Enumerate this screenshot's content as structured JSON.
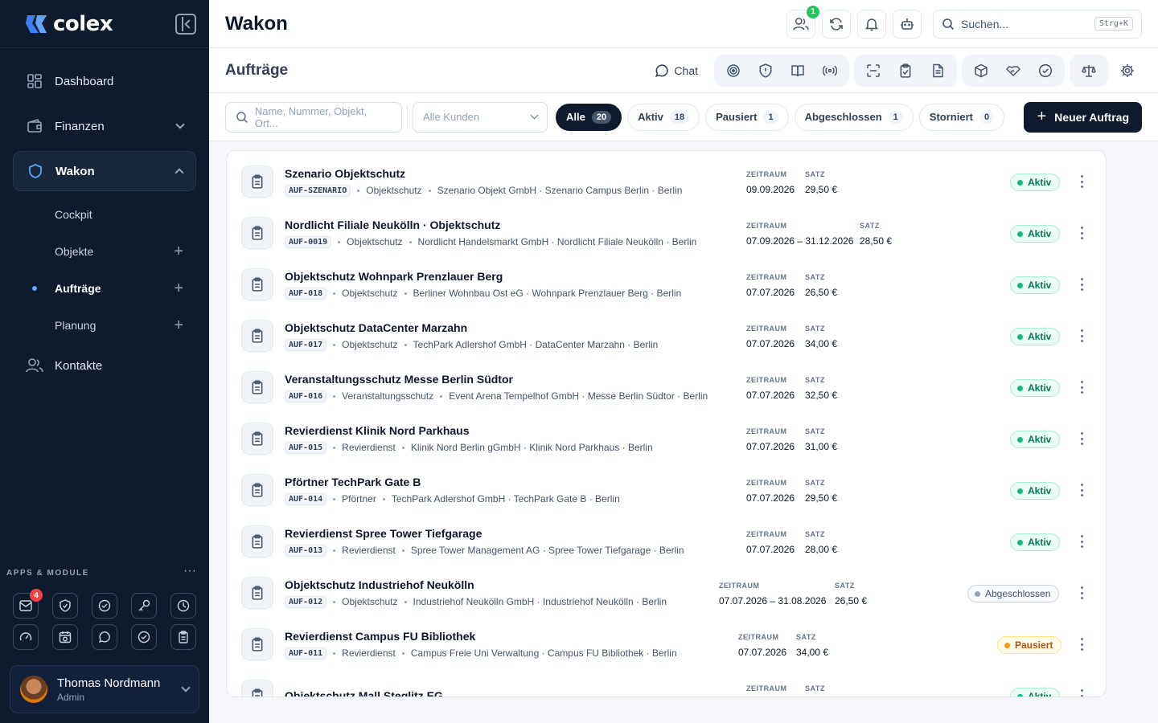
{
  "brand": {
    "name": "colex"
  },
  "sidebar": {
    "items": [
      {
        "label": "Dashboard"
      },
      {
        "label": "Finanzen"
      },
      {
        "label": "Wakon"
      },
      {
        "label": "Kontakte"
      }
    ],
    "sub": [
      {
        "label": "Cockpit"
      },
      {
        "label": "Objekte",
        "plus": "+"
      },
      {
        "label": "Aufträge",
        "plus": "+"
      },
      {
        "label": "Planung",
        "plus": "+"
      }
    ],
    "apps_title": "APPS & MODULE",
    "apps_more": "···",
    "mail_badge": "4",
    "user": {
      "name": "Thomas Nordmann",
      "role": "Admin"
    }
  },
  "topbar": {
    "title": "Wakon",
    "team_badge": "1",
    "search_placeholder": "Suchen...",
    "shortcut": "Strg+K"
  },
  "section": {
    "title": "Aufträge",
    "chat_label": "Chat"
  },
  "filters": {
    "search_placeholder": "Name, Nummer, Objekt, Ort...",
    "customer_placeholder": "Alle Kunden",
    "pills": [
      {
        "label": "Alle",
        "count": "20"
      },
      {
        "label": "Aktiv",
        "count": "18"
      },
      {
        "label": "Pausiert",
        "count": "1"
      },
      {
        "label": "Abgeschlossen",
        "count": "1"
      },
      {
        "label": "Storniert",
        "count": "0"
      }
    ],
    "new_label": "Neuer Auftrag"
  },
  "labels": {
    "zeitraum": "ZEITRAUM",
    "satz": "SATZ"
  },
  "orders": [
    {
      "title": "Szenario Objektschutz",
      "code": "AUF-SZENARIO",
      "type": "Objektschutz",
      "location": "Szenario Objekt GmbH · Szenario Campus Berlin · Berlin",
      "zeitraum": "09.09.2026",
      "satz": "29,50 €",
      "status": "Aktiv"
    },
    {
      "title": "Nordlicht Filiale Neukölln · Objektschutz",
      "code": "AUF-0019",
      "type": "Objektschutz",
      "location": "Nordlicht Handelsmarkt GmbH · Nordlicht Filiale Neukölln · Berlin",
      "zeitraum": "07.09.2026 – 31.12.2026",
      "satz": "28,50 €",
      "status": "Aktiv"
    },
    {
      "title": "Objektschutz Wohnpark Prenzlauer Berg",
      "code": "AUF-018",
      "type": "Objektschutz",
      "location": "Berliner Wohnbau Ost eG · Wohnpark Prenzlauer Berg · Berlin",
      "zeitraum": "07.07.2026",
      "satz": "26,50 €",
      "status": "Aktiv"
    },
    {
      "title": "Objektschutz DataCenter Marzahn",
      "code": "AUF-017",
      "type": "Objektschutz",
      "location": "TechPark Adlershof GmbH · DataCenter Marzahn · Berlin",
      "zeitraum": "07.07.2026",
      "satz": "34,00 €",
      "status": "Aktiv"
    },
    {
      "title": "Veranstaltungsschutz Messe Berlin Südtor",
      "code": "AUF-016",
      "type": "Veranstaltungsschutz",
      "location": "Event Arena Tempelhof GmbH · Messe Berlin Südtor · Berlin",
      "zeitraum": "07.07.2026",
      "satz": "32,50 €",
      "status": "Aktiv"
    },
    {
      "title": "Revierdienst Klinik Nord Parkhaus",
      "code": "AUF-015",
      "type": "Revierdienst",
      "location": "Klinik Nord Berlin gGmbH · Klinik Nord Parkhaus · Berlin",
      "zeitraum": "07.07.2026",
      "satz": "31,00 €",
      "status": "Aktiv"
    },
    {
      "title": "Pförtner TechPark Gate B",
      "code": "AUF-014",
      "type": "Pförtner",
      "location": "TechPark Adlershof GmbH · TechPark Gate B · Berlin",
      "zeitraum": "07.07.2026",
      "satz": "29,50 €",
      "status": "Aktiv"
    },
    {
      "title": "Revierdienst Spree Tower Tiefgarage",
      "code": "AUF-013",
      "type": "Revierdienst",
      "location": "Spree Tower Management AG · Spree Tower Tiefgarage · Berlin",
      "zeitraum": "07.07.2026",
      "satz": "28,00 €",
      "status": "Aktiv"
    },
    {
      "title": "Objektschutz Industriehof Neukölln",
      "code": "AUF-012",
      "type": "Objektschutz",
      "location": "Industriehof Neukölln GmbH · Industriehof Neukölln · Berlin",
      "zeitraum": "07.07.2026 – 31.08.2026",
      "satz": "26,50 €",
      "status": "Abgeschlossen"
    },
    {
      "title": "Revierdienst Campus FU Bibliothek",
      "code": "AUF-011",
      "type": "Revierdienst",
      "location": "Campus Freie Uni Verwaltung · Campus FU Bibliothek · Berlin",
      "zeitraum": "07.07.2026",
      "satz": "34,00 €",
      "status": "Pausiert"
    },
    {
      "title": "Objektschutz Mall Steglitz EG",
      "code": "",
      "type": "",
      "location": "",
      "zeitraum": "",
      "satz": "",
      "status": "Aktiv"
    }
  ]
}
